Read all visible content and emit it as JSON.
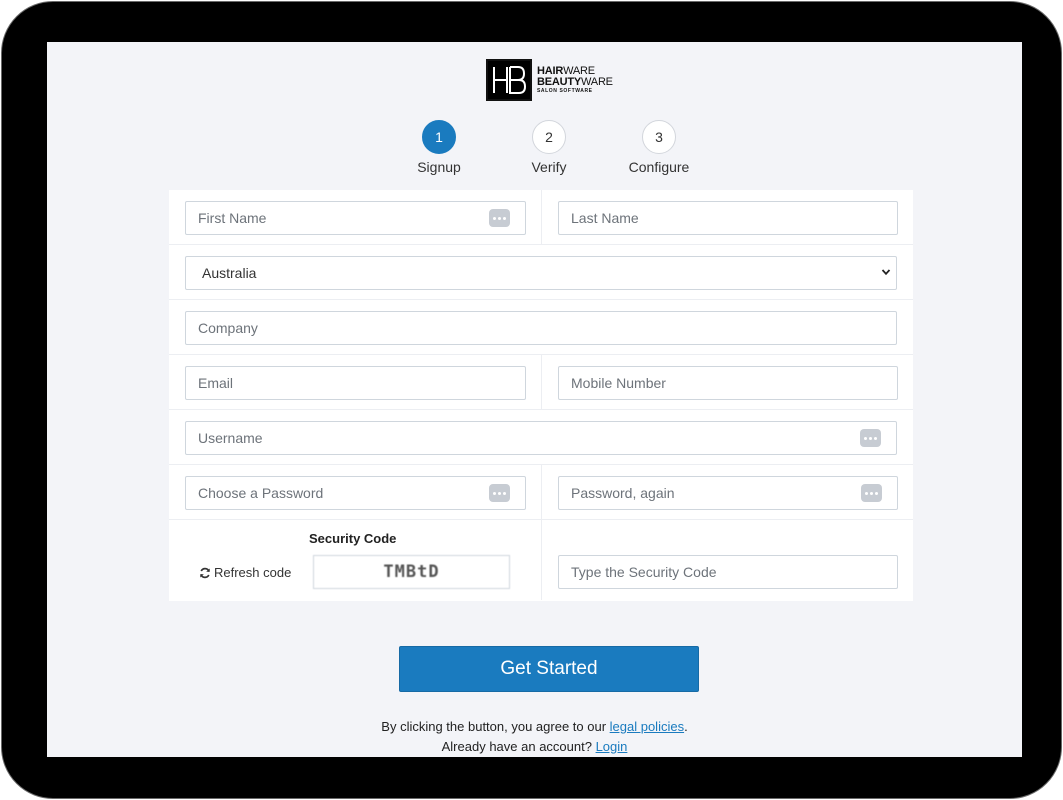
{
  "logo": {
    "line1_bold": "HAIR",
    "line1_thin": "WARE",
    "line2_bold": "BEAUTY",
    "line2_thin": "WARE",
    "tagline": "SALON SOFTWARE"
  },
  "steps": [
    {
      "number": "1",
      "label": "Signup",
      "active": true
    },
    {
      "number": "2",
      "label": "Verify",
      "active": false
    },
    {
      "number": "3",
      "label": "Configure",
      "active": false
    }
  ],
  "form": {
    "first_name_placeholder": "First Name",
    "last_name_placeholder": "Last Name",
    "country_value": "Australia",
    "company_placeholder": "Company",
    "email_placeholder": "Email",
    "mobile_placeholder": "Mobile Number",
    "username_placeholder": "Username",
    "password_placeholder": "Choose a Password",
    "password_again_placeholder": "Password, again",
    "security_code_label": "Security Code",
    "refresh_label": "Refresh code",
    "captcha_text": "TMBtD",
    "security_code_placeholder": "Type the Security Code"
  },
  "actions": {
    "get_started_label": "Get Started",
    "legal_prefix": "By clicking the button, you agree to our ",
    "legal_link": "legal policies",
    "legal_suffix": ".",
    "account_prefix": "Already have an account? ",
    "login_link": "Login"
  },
  "colors": {
    "accent": "#1a7bbf",
    "background": "#f3f4f8",
    "password_icon": "#c7ccd3"
  },
  "icons": {
    "password_manager": "ellipsis-key-icon",
    "refresh": "refresh-icon",
    "select_chevron": "chevron-down-icon"
  }
}
